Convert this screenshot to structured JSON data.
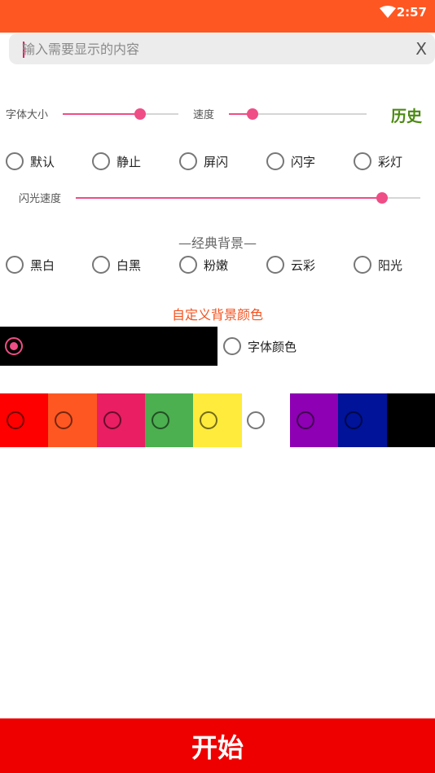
{
  "status_bar": {
    "time": "2:57",
    "wifi_icon": "wifi-icon"
  },
  "input": {
    "placeholder": "输入需要显示的内容",
    "value": "",
    "clear_label": "X"
  },
  "controls": {
    "font_size_label": "字体大小",
    "font_size_value": 0.67,
    "speed_label": "速度",
    "speed_value": 0.17,
    "history_label": "历史"
  },
  "modes": [
    "默认",
    "静止",
    "屏闪",
    "闪字",
    "彩灯"
  ],
  "flash_speed": {
    "label": "闪光速度",
    "value": 0.89
  },
  "classic_bg": {
    "title": "—经典背景—",
    "options": [
      "黑白",
      "白黑",
      "粉嫩",
      "云彩",
      "阳光"
    ]
  },
  "custom_color": {
    "title": "自定义背景颜色",
    "selected_bg_color": "#000000",
    "font_color_label": "字体颜色"
  },
  "palette": [
    "#ff0000",
    "#ff5722",
    "#e91e63",
    "#4caf50",
    "#ffeb3b",
    "#ffffff",
    "#8e00b3",
    "#001399",
    "#000000"
  ],
  "start_button": {
    "label": "开始",
    "color": "#ee0000"
  },
  "colors": {
    "accent": "#ff5722",
    "slider": "#ef4d86",
    "history": "#4c8a12"
  }
}
